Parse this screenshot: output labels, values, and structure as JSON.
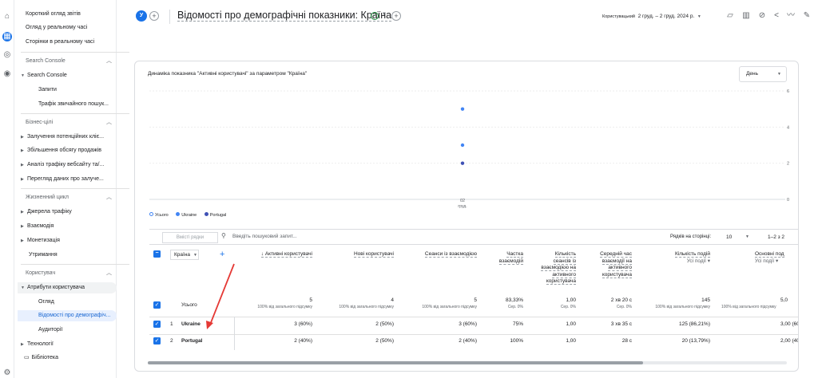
{
  "sidebar": {
    "items": [
      {
        "label": "Короткий огляд звітів"
      },
      {
        "label": "Огляд у реальному часі"
      },
      {
        "label": "Сторінки в реальному часі"
      }
    ],
    "search_console": {
      "header": "Search Console",
      "group": "Search Console",
      "items": [
        "Запити",
        "Трафік звичайного пошук..."
      ]
    },
    "business": {
      "header": "Бізнес-цілі",
      "items": [
        "Залучення потенційних кліє...",
        "Збільшення обсягу продажів",
        "Аналіз трафіку вебсайту та/...",
        "Перегляд даних про залуче..."
      ]
    },
    "lifecycle": {
      "header": "Жизненний цикл",
      "items": [
        "Джерела трафіку",
        "Взаємодія",
        "Монетизація",
        "Утримання"
      ]
    },
    "user": {
      "header": "Користувач",
      "group": "Атрибути користувача",
      "items": [
        "Огляд",
        "Відомості про демографіч...",
        "Аудиторії"
      ],
      "extra": [
        "Технології",
        "Бібліотека"
      ]
    }
  },
  "header": {
    "avatar": "У",
    "title": "Відомості про демографічні показники: Країна",
    "date_label": "Користувацький",
    "date_range": "2 груд. – 2 груд. 2024 р."
  },
  "chart": {
    "title": "Динаміка показника \"Активні користувачі\" за параметром \"Країна\"",
    "granularity": "День",
    "x_tick": "02",
    "x_tick_sub": "груд.",
    "legend": [
      "Усього",
      "Ukraine",
      "Portugal"
    ]
  },
  "chart_data": {
    "type": "scatter",
    "x": [
      "02 груд."
    ],
    "series": [
      {
        "name": "Усього",
        "values": [
          5
        ]
      },
      {
        "name": "Ukraine",
        "values": [
          3
        ]
      },
      {
        "name": "Portugal",
        "values": [
          2
        ]
      }
    ],
    "y_ticks": [
      "0",
      "2",
      "4",
      "6"
    ],
    "ylim": [
      0,
      6
    ],
    "colors": {
      "Усього": "#ffffff",
      "Ukraine": "#4285f4",
      "Portugal": "#3f51b5"
    }
  },
  "table": {
    "rows_placeholder": "Вмісті рядки",
    "search_placeholder": "Введіть пошуковий запит...",
    "rows_per_page_label": "Рядків на сторінці:",
    "rows_per_page": "10",
    "pagination": "1–2 з 2",
    "dimension": "Країна",
    "metrics": [
      {
        "label": "↓ Активні користувачі",
        "sub": ""
      },
      {
        "label": "Нові користувачі",
        "sub": ""
      },
      {
        "label": "Сеанси із взаємодією",
        "sub": ""
      },
      {
        "label": "Частка взаємодій",
        "sub": ""
      },
      {
        "label": "Кількість сеансів із взаємодією на активного користувача",
        "sub": ""
      },
      {
        "label": "Середній час взаємодії на активного користувача",
        "sub": ""
      },
      {
        "label": "Кількість подій",
        "sub": "Усі події ▾"
      },
      {
        "label": "Основні под",
        "sub": "Усі події ▾"
      }
    ],
    "totals": {
      "label": "Усього",
      "values": [
        "5",
        "4",
        "5",
        "83,33%",
        "1,00",
        "2 хв 20 с",
        "145",
        "5,0"
      ],
      "subs": [
        "100% від загального підсумку",
        "100% від загального підсумку",
        "100% від загального підсумку",
        "Сер. 0%",
        "Сер. 0%",
        "Сер. 0%",
        "100% від загального підсумку",
        "100% від загального підсумку"
      ]
    },
    "rows": [
      {
        "num": "1",
        "country": "Ukraine",
        "values": [
          "3 (60%)",
          "2 (50%)",
          "3 (60%)",
          "75%",
          "1,00",
          "3 хв 35 с",
          "125 (86,21%)",
          "3,00 (60"
        ]
      },
      {
        "num": "2",
        "country": "Portugal",
        "values": [
          "2 (40%)",
          "2 (50%)",
          "2 (40%)",
          "100%",
          "1,00",
          "28 с",
          "20 (13,79%)",
          "2,00 (40"
        ]
      }
    ]
  }
}
